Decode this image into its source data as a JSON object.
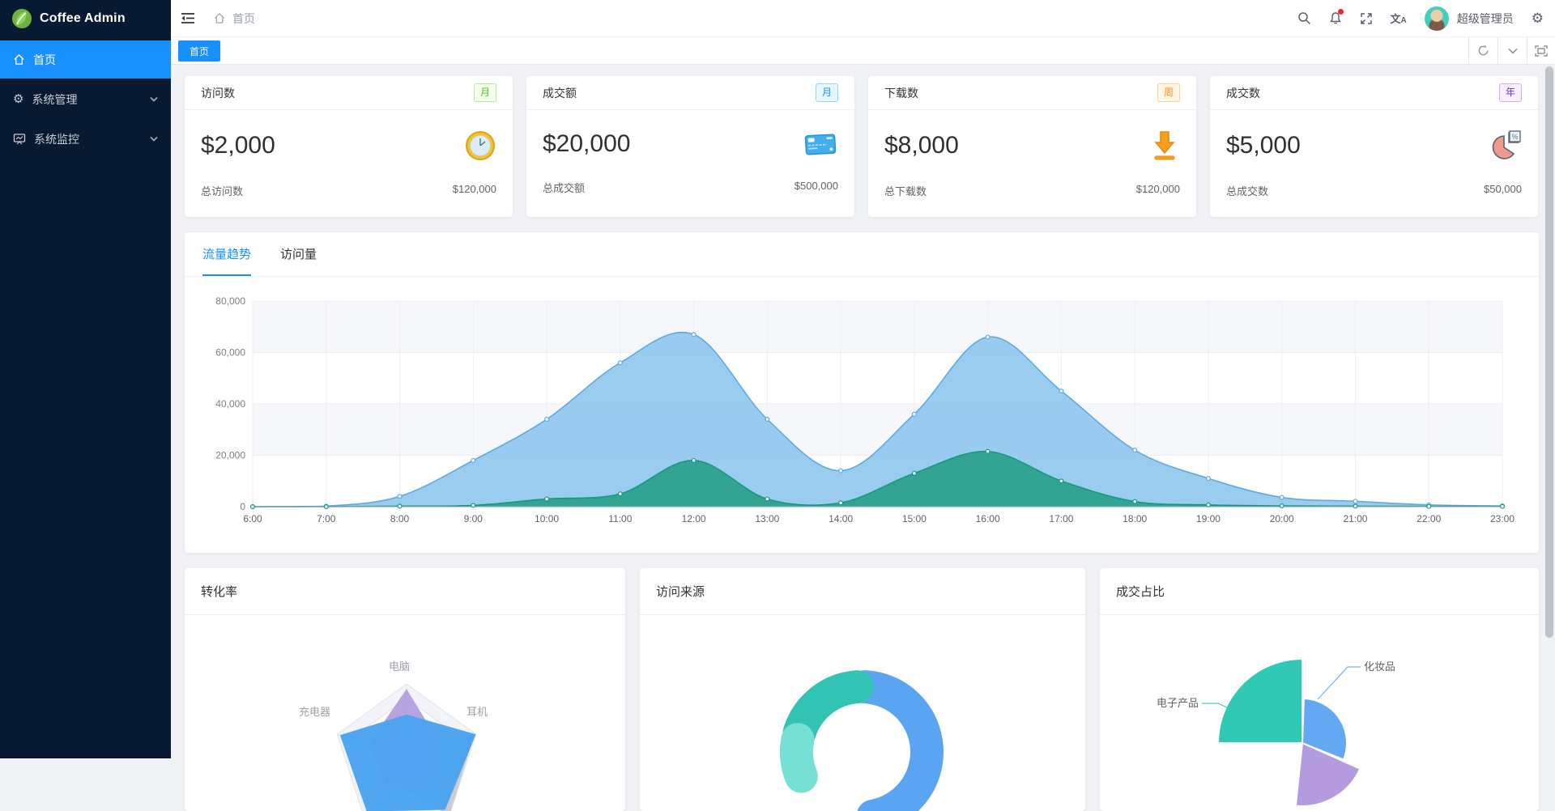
{
  "app": {
    "logo_text": "Coffee Admin"
  },
  "sidebar": {
    "items": [
      {
        "label": "首页",
        "active": true
      },
      {
        "label": "系统管理",
        "active": false
      },
      {
        "label": "系统监控",
        "active": false
      }
    ]
  },
  "navbar": {
    "breadcrumb_home": "首页",
    "username": "超级管理员"
  },
  "tabs_bar": {
    "active_tab": "首页"
  },
  "stat_cards": [
    {
      "title": "访问数",
      "badge": "月",
      "badge_color": "#52c41a",
      "badge_bg": "#f6ffed",
      "badge_border": "#b7eb8f",
      "value": "$2,000",
      "foot_label": "总访问数",
      "foot_value": "$120,000",
      "icon": "clock-icon"
    },
    {
      "title": "成交额",
      "badge": "月",
      "badge_color": "#1890ff",
      "badge_bg": "#e6f7ff",
      "badge_border": "#91d5ff",
      "value": "$20,000",
      "foot_label": "总成交额",
      "foot_value": "$500,000",
      "icon": "bank-card-icon"
    },
    {
      "title": "下载数",
      "badge": "周",
      "badge_color": "#fa8c16",
      "badge_bg": "#fff7e6",
      "badge_border": "#ffd591",
      "value": "$8,000",
      "foot_label": "总下载数",
      "foot_value": "$120,000",
      "icon": "download-icon"
    },
    {
      "title": "成交数",
      "badge": "年",
      "badge_color": "#722ed1",
      "badge_bg": "#f9f0ff",
      "badge_border": "#d3adf7",
      "value": "$5,000",
      "foot_label": "总成交数",
      "foot_value": "$50,000",
      "icon": "pie-icon"
    }
  ],
  "main_chart": {
    "tabs": [
      "流量趋势",
      "访问量"
    ],
    "active_tab": "流量趋势",
    "chart_data": {
      "type": "area",
      "x": [
        "6:00",
        "7:00",
        "8:00",
        "9:00",
        "10:00",
        "11:00",
        "12:00",
        "13:00",
        "14:00",
        "15:00",
        "16:00",
        "17:00",
        "18:00",
        "19:00",
        "20:00",
        "21:00",
        "22:00",
        "23:00"
      ],
      "y_ticks": [
        "0",
        "20,000",
        "40,000",
        "60,000",
        "80,000"
      ],
      "ylim": [
        0,
        80000
      ],
      "grid": true,
      "legend_position": "none",
      "series": [
        {
          "color": "#5ca9e6",
          "fill": "#8cc5ee",
          "fill_opacity": 0.88,
          "values": [
            0,
            200,
            4000,
            18000,
            34000,
            56000,
            67000,
            34000,
            14000,
            36000,
            66000,
            45000,
            22000,
            11000,
            3600,
            2100,
            700,
            300
          ]
        },
        {
          "color": "#14997f",
          "fill": "#2aa189",
          "fill_opacity": 0.92,
          "values": [
            0,
            0,
            200,
            500,
            3000,
            5000,
            18000,
            3000,
            1500,
            13000,
            21500,
            10000,
            2000,
            700,
            300,
            200,
            100,
            100
          ]
        }
      ]
    }
  },
  "bottom_cards": {
    "radar": {
      "title": "转化率",
      "chart_data": {
        "type": "radar",
        "indicators": [
          "电脑",
          "耳机",
          "",
          "",
          "充电器"
        ],
        "rings": [
          1,
          0.8,
          0.6,
          0.4,
          0.2
        ],
        "series": [
          {
            "color": "#c8cacd",
            "fractions": [
              0.5,
              0.98,
              1.0,
              0.4,
              0.4
            ]
          },
          {
            "color": "#b49fe0",
            "fractions": [
              0.93,
              0.5,
              0.45,
              0.45,
              0.55
            ]
          },
          {
            "color": "#4aa2ef",
            "fractions": [
              0.58,
              1.0,
              0.9,
              0.93,
              0.96
            ]
          }
        ]
      }
    },
    "donut": {
      "title": "访问来源",
      "chart_data": {
        "type": "donut",
        "segments": [
          {
            "color": "#5ba4f2",
            "start_deg": 3,
            "end_deg": 170
          },
          {
            "color": "#33c3b5",
            "start_deg": -73,
            "end_deg": -4
          },
          {
            "color": "#77e0d4",
            "start_deg": -112,
            "end_deg": -79
          }
        ]
      }
    },
    "rose": {
      "title": "成交占比",
      "chart_data": {
        "type": "pie-rose",
        "segments": [
          {
            "label": "电子产品",
            "color": "#2fc9b6",
            "radius": 104,
            "start_deg": -90,
            "end_deg": 0
          },
          {
            "label": "化妆品",
            "color": "#64a8f4",
            "radius": 55,
            "start_deg": 2,
            "end_deg": 112
          },
          {
            "label": "",
            "color": "#b49be0",
            "radius": 78,
            "start_deg": 114,
            "end_deg": 186
          }
        ]
      }
    }
  }
}
